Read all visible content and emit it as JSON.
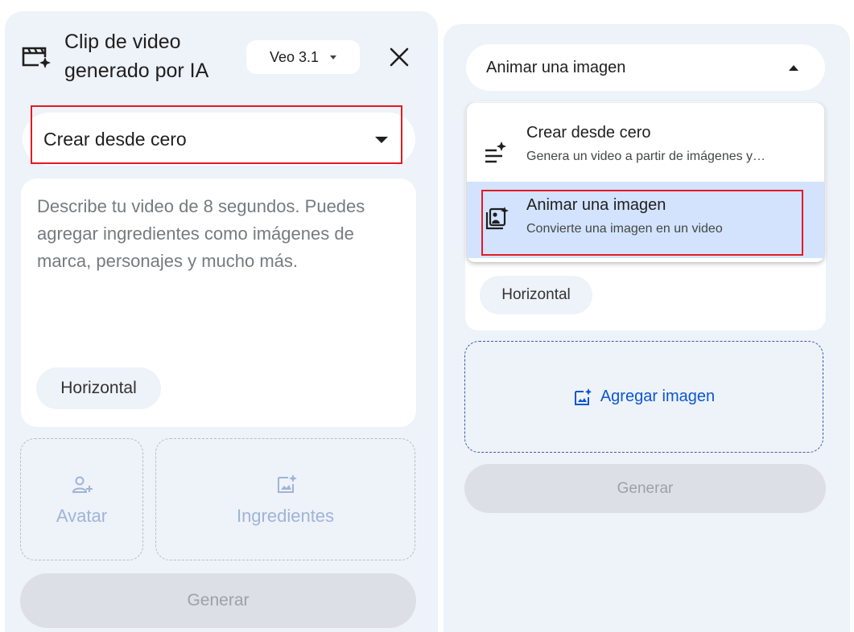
{
  "left_panel": {
    "title": "Clip de video generado por IA",
    "model_label": "Veo 3.1",
    "mode_label": "Crear desde cero",
    "prompt_placeholder": "Describe tu video de 8 segundos. Puedes agregar ingredientes como imágenes de marca, personajes y mucho más.",
    "aspect_chip": "Horizontal",
    "avatar_label": "Avatar",
    "ingredients_label": "Ingredientes",
    "generate_label": "Generar"
  },
  "right_panel": {
    "mode_label": "Animar una imagen",
    "menu_items": [
      {
        "title": "Crear desde cero",
        "desc": "Genera un video a partir de imágenes y…",
        "icon": "text-spark-icon"
      },
      {
        "title": "Animar una imagen",
        "desc": "Convierte una imagen en un video",
        "icon": "image-animate-icon",
        "selected": true
      }
    ],
    "aspect_chip": "Horizontal",
    "add_image_label": "Agregar imagen",
    "generate_label": "Generar"
  },
  "colors": {
    "panel_bg": "#eef2f9",
    "highlight_red": "#e31b23",
    "selected_bg": "#d3e3fd",
    "link_blue": "#0b57d0",
    "disabled_text": "#9ea2a8"
  }
}
